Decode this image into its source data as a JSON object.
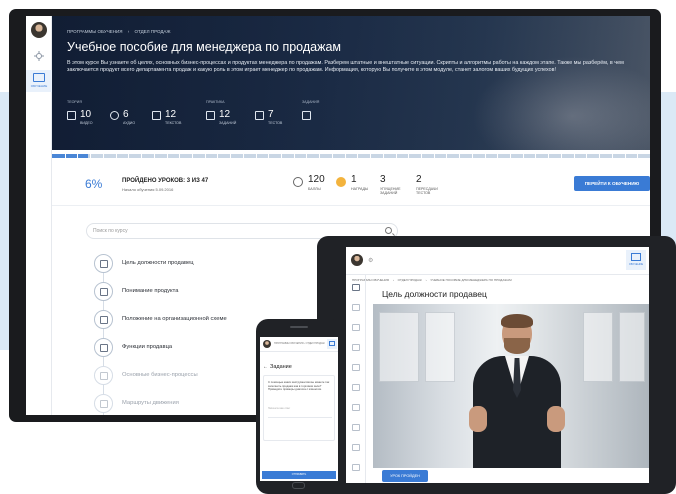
{
  "sidebar": {
    "active_label": "ОБУЧЕНИЕ"
  },
  "breadcrumb": [
    "ПРОГРАММЫ ОБУЧЕНИЯ",
    "›",
    "ОТДЕЛ ПРОДАЖ"
  ],
  "course": {
    "title": "Учебное пособие для менеджера по продажам",
    "description": "В этом курсе Вы узнаете об целях, основных бизнес-процессах и продуктах менеджера по продажам. Разберем штатные и внештатные ситуации. Скрипты и алгоритмы работы на каждом этапе. Также мы разберём, в чем заключается продукт всего департамента продаж и какую роль в этом играет менеджер по продажам. Информация, которую Вы получите в этом модуле, станет залогом ваших будущих успехов!"
  },
  "stat_categories": [
    "ТЕОРИЯ",
    "ПРАКТИКА",
    "ЗАДАНИЯ"
  ],
  "stats": [
    {
      "icon": "video-icon",
      "value": "10",
      "label": "ВИДЕО"
    },
    {
      "icon": "audio-icon",
      "value": "6",
      "label": "АУДИО"
    },
    {
      "icon": "text-icon",
      "value": "12",
      "label": "ТЕКСТОВ"
    },
    {
      "icon": "task-icon",
      "value": "12",
      "label": "ЗАДАНИЙ"
    },
    {
      "icon": "test-icon",
      "value": "7",
      "label": "ТЕСТОВ"
    }
  ],
  "progress": {
    "percent": "6%",
    "fraction": 0.06,
    "passed_text": "ПРОЙДЕНО УРОКОВ: 3 ИЗ 47",
    "started_text": "Начало обучения 5.09.2016"
  },
  "kpis": [
    {
      "value": "120",
      "label": "БАЛЛЫ"
    },
    {
      "value": "1",
      "label": "НАГРАДЫ"
    },
    {
      "value": "3",
      "label": "УПУЩЕНИЕ\nЗАДАНИЙ"
    },
    {
      "value": "2",
      "label": "ПЕРЕСДАЧИ\nТЕСТОВ"
    }
  ],
  "go_button": "ПЕРЕЙТИ К ОБУЧЕНИЮ",
  "search": {
    "placeholder": "Поиск по курсу"
  },
  "lessons": [
    {
      "icon": "video-icon",
      "title": "Цель должности продавец"
    },
    {
      "icon": "question-icon",
      "title": "Понимание продукта"
    },
    {
      "icon": "text-icon",
      "title": "Положение на организационной схеме"
    },
    {
      "icon": "list-icon",
      "title": "Функции продавца"
    },
    {
      "icon": "text-icon",
      "title": "Основные бизнес-процессы"
    },
    {
      "icon": "question-icon",
      "title": "Маршруты движения"
    }
  ],
  "tablet": {
    "breadcrumb": [
      "ПРОГРАММЫ ОБУЧЕНИЯ",
      "›",
      "ОТДЕЛ ПРОДАЖ",
      "›",
      "УЧЕБНОЕ ПОСОБИЕ ДЛЯ МЕНЕДЖЕРА ПО ПРОДАЖАМ"
    ],
    "active_label": "ОБУЧЕНИЕ",
    "lesson_title": "Цель должности продавец",
    "button": "УРОК ПРОЙДЕН"
  },
  "phone": {
    "breadcrumb": "ПРОГРАММЫ ОБУЧЕНИЯ › ОТДЕЛ ПРОДАЖ",
    "task_title": "Задание",
    "task_text": "С помощью каких инструментов вы можете так заполнить продажи как в торговом зале? Приведите примеры диалога с клиентом.",
    "answer_placeholder": "Напишите ваш ответ",
    "button": "ОТПРАВИТЬ"
  },
  "colors": {
    "accent": "#3a7bd5",
    "band": "#dbe9f6",
    "device": "#1a1b1e"
  }
}
